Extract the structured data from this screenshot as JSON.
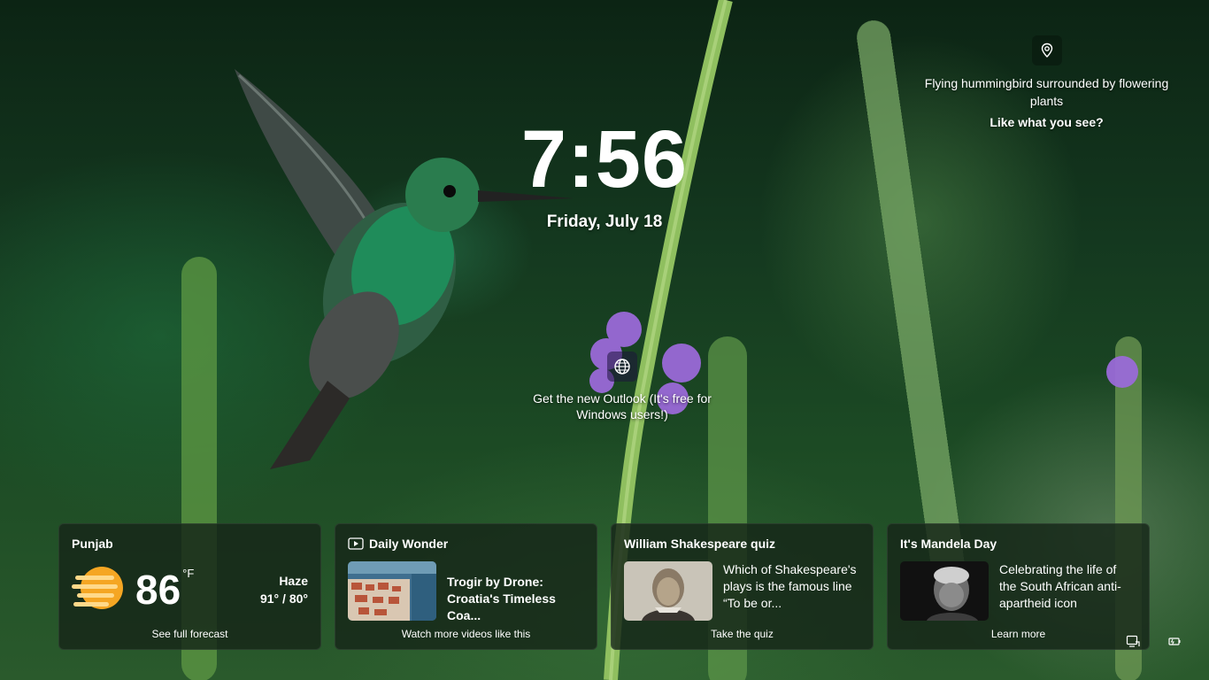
{
  "clock": {
    "time": "7:56",
    "date": "Friday, July 18"
  },
  "spotlight": {
    "icon": "location-pin-icon",
    "description": "Flying hummingbird surrounded by flowering plants",
    "like_prompt": "Like what you see?"
  },
  "promo": {
    "icon": "globe-icon",
    "text": "Get the new Outlook (It's free for Windows users!)"
  },
  "cards": {
    "weather": {
      "location": "Punjab",
      "temperature": "86",
      "unit": "°F",
      "condition": "Haze",
      "range": "91° / 80°",
      "footer": "See full forecast",
      "icon": "haze-sun-icon"
    },
    "wonder": {
      "title": "Daily Wonder",
      "icon": "video-icon",
      "headline": "Trogir by Drone: Croatia's Timeless Coa...",
      "footer": "Watch more videos like this"
    },
    "quiz": {
      "title": "William Shakespeare quiz",
      "text": "Which of Shakespeare's plays is the famous line “To be or...",
      "footer": "Take the quiz"
    },
    "mandela": {
      "title": "It's Mandela Day",
      "text": "Celebrating the life of the South African anti-apartheid icon",
      "footer": "Learn more"
    }
  },
  "status": {
    "icons": [
      "network-icon",
      "battery-icon"
    ]
  },
  "colors": {
    "card_bg": "#162618",
    "accent_sun": "#F5A623"
  }
}
